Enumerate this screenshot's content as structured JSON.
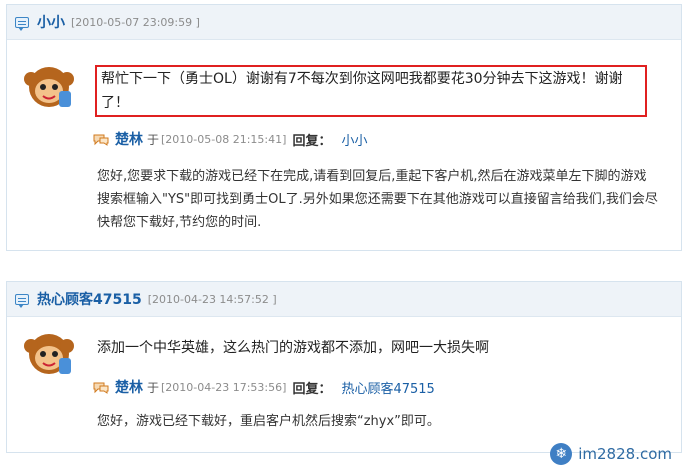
{
  "posts": [
    {
      "user": "小小",
      "time": "[2010-05-07 23:09:59 ]",
      "question": "帮忙下一下（勇士OL）谢谢有7不每次到你这网吧我都要花30分钟去下这游戏！谢谢了！",
      "reply": {
        "name": "楚林",
        "yu": "于",
        "time": "[2010-05-08 21:15:41]",
        "label": "回复：",
        "target": "小小",
        "text": "您好,您要求下载的游戏已经下在完成,请看到回复后,重起下客户机,然后在游戏菜单左下脚的游戏搜索框输入\"YS\"即可找到勇士OL了.另外如果您还需要下在其他游戏可以直接留言给我们,我们会尽快帮您下载好,节约您的时间."
      }
    },
    {
      "user": "热心顾客47515",
      "time": "[2010-04-23 14:57:52 ]",
      "question": "添加一个中华英雄，这么热门的游戏都不添加，网吧一大损失啊",
      "reply": {
        "name": "楚林",
        "yu": "于",
        "time": "[2010-04-23 17:53:56]",
        "label": "回复：",
        "target": "热心顾客47515",
        "text": "您好，游戏已经下载好，重启客户机然后搜索“zhyx”即可。"
      }
    }
  ],
  "watermark": {
    "text": "im2828.com",
    "icon": "snowflake-icon"
  }
}
